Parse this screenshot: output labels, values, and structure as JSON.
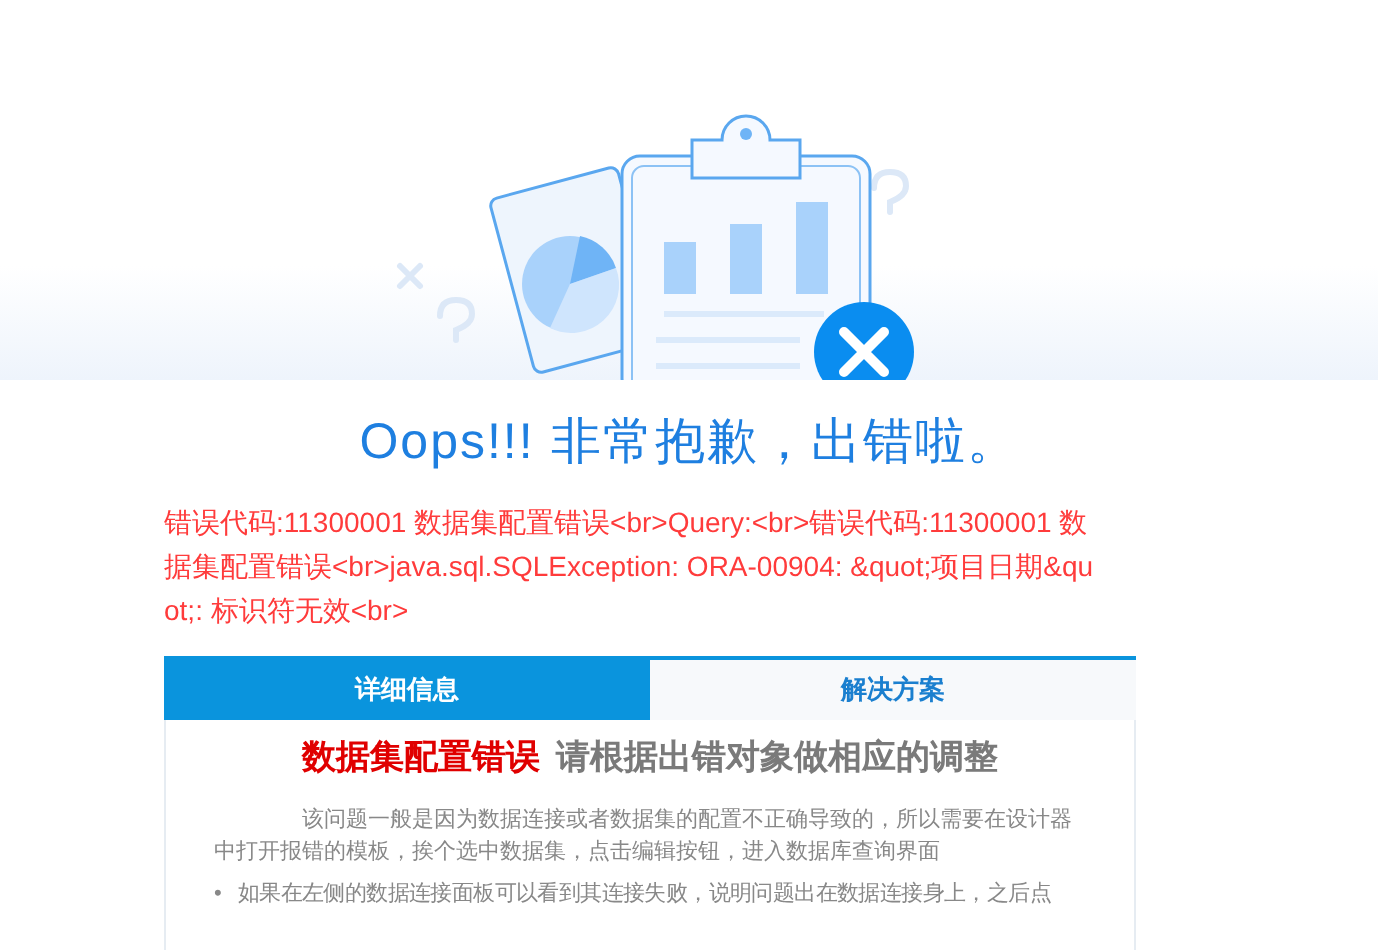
{
  "title": "Oops!!! 非常抱歉，出错啦。",
  "error_message": "错误代码:11300001 数据集配置错误<br>Query:<br>错误代码:11300001 数据集配置错误<br>java.sql.SQLException: ORA-00904: &quot;项目日期&quot;: 标识符无效<br>",
  "tabs": [
    {
      "label": "详细信息",
      "selected": true
    },
    {
      "label": "解决方案",
      "selected": false
    }
  ],
  "detail": {
    "error_type": "数据集配置错误",
    "heading": "请根据出错对象做相应的调整",
    "paragraph": "该问题一般是因为数据连接或者数据集的配置不正确导致的，所以需要在设计器中打开报错的模板，挨个选中数据集，点击编辑按钮，进入数据库查询界面",
    "bullets": [
      {
        "marker": "•",
        "text": "如果在左侧的数据连接面板可以看到其连接失败，说明问题出在数据连接身上，之后点"
      }
    ]
  }
}
